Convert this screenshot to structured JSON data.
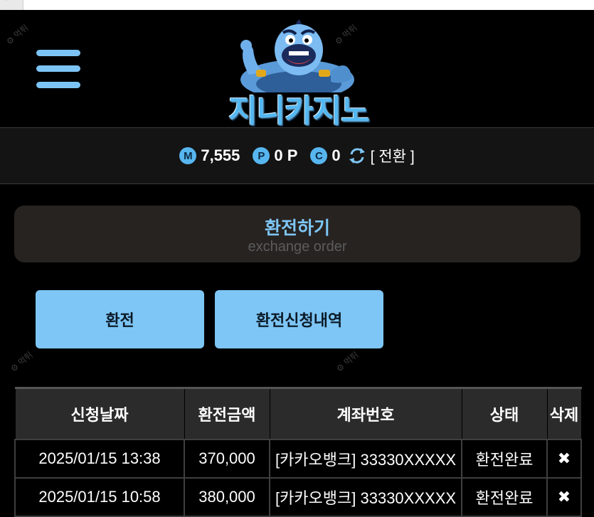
{
  "header": {
    "logo_text": "지니카지노"
  },
  "balance": {
    "m_icon": "M",
    "m_value": "7,555",
    "p_icon": "P",
    "p_value": "0 P",
    "c_icon": "C",
    "c_value": "0",
    "convert_label": "[ 전환 ]"
  },
  "section": {
    "title": "환전하기",
    "subtitle": "exchange order"
  },
  "buttons": {
    "exchange": "환전",
    "history": "환전신청내역"
  },
  "table": {
    "headers": [
      "신청날짜",
      "환전금액",
      "계좌번호",
      "상태",
      "삭제"
    ],
    "rows": [
      {
        "date": "2025/01/15 13:38",
        "amount": "370,000",
        "account": "[카카오뱅크] 33330XXXXX",
        "status": "환전완료",
        "delete": "✖"
      },
      {
        "date": "2025/01/15 10:58",
        "amount": "380,000",
        "account": "[카카오뱅크] 33330XXXXX",
        "status": "환전완료",
        "delete": "✖"
      }
    ]
  },
  "colors": {
    "accent": "#7ec6f5",
    "background": "#000000",
    "panel": "#272321"
  },
  "icons": [
    "hamburger-menu-icon",
    "genie-logo",
    "m-coin-icon",
    "p-coin-icon",
    "c-coin-icon",
    "refresh-icon",
    "delete-icon"
  ]
}
